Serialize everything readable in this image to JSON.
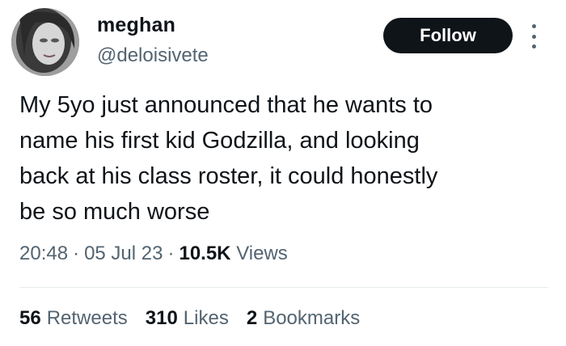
{
  "author": {
    "display_name": "meghan",
    "handle": "@deloisivete"
  },
  "actions": {
    "follow_label": "Follow",
    "more_icon": "more-vertical-icon"
  },
  "tweet": {
    "text": "My 5yo just announced that he wants to\nname his first kid Godzilla, and looking\nback at his class roster, it could honestly\nbe so much worse",
    "time": "20:48",
    "date": "05 Jul 23",
    "views_count": "10.5K",
    "views_label": "Views"
  },
  "stats": {
    "retweets": {
      "count": "56",
      "label": "Retweets"
    },
    "likes": {
      "count": "310",
      "label": "Likes"
    },
    "bookmarks": {
      "count": "2",
      "label": "Bookmarks"
    }
  },
  "colors": {
    "text": "#0f1419",
    "secondary": "#536471",
    "button_bg": "#0f1419",
    "button_text": "#ffffff",
    "divider": "#e6ecf0"
  }
}
